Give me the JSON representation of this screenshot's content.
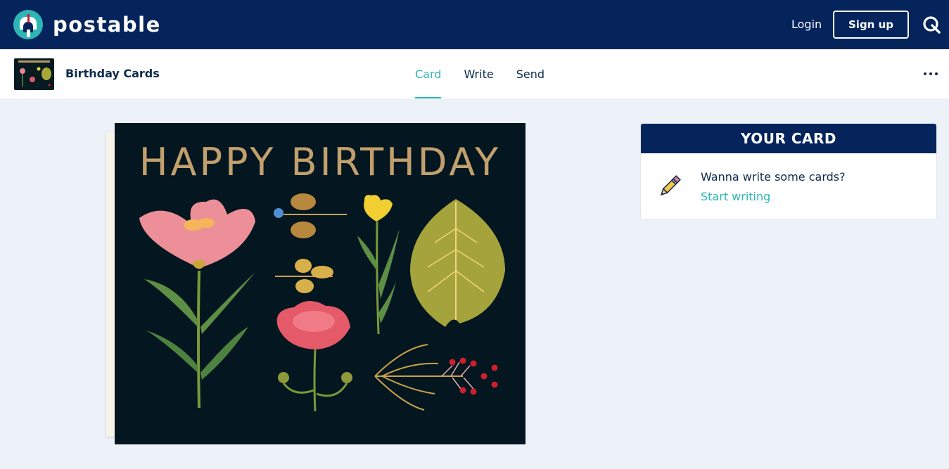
{
  "brand": {
    "name": "postable"
  },
  "header": {
    "login_label": "Login",
    "signup_label": "Sign up",
    "search_icon": "search-icon"
  },
  "subnav": {
    "title": "Birthday Cards",
    "tabs": [
      {
        "label": "Card",
        "active": true
      },
      {
        "label": "Write",
        "active": false
      },
      {
        "label": "Send",
        "active": false
      }
    ],
    "more_icon": "more-icon"
  },
  "card_preview": {
    "greeting": "HAPPY BIRTHDAY"
  },
  "panel": {
    "title": "YOUR CARD",
    "question": "Wanna write some cards?",
    "link_label": "Start writing",
    "icon": "pencil-icon"
  },
  "colors": {
    "navy": "#05245c",
    "teal": "#2fb5b6",
    "gold": "#c2a06d",
    "card_bg": "#04161f"
  }
}
